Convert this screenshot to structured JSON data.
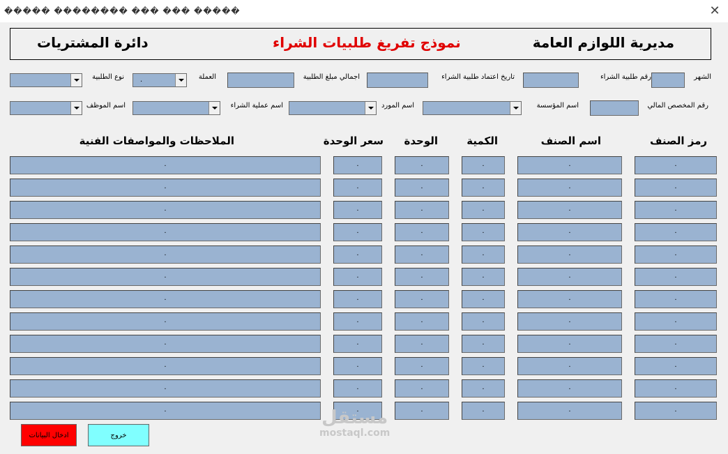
{
  "window": {
    "title": "����� �������� ��� ��� �����"
  },
  "header": {
    "org": "مديرية اللوازم العامة",
    "form_title": "نموذج تفريغ طلبيات الشراء",
    "dept": "دائرة المشتريات"
  },
  "colors": {
    "field": "#9ab3d1",
    "title_red": "#e00000",
    "btn_enter": "#ff0000",
    "btn_exit": "#80ffff"
  },
  "row1": {
    "month": "الشهر",
    "po_number": "رقم طلبية الشراء",
    "po_approval_date": "تاريخ اعتماد طلبية الشراء",
    "po_total": "اجمالي مبلغ الطلبية",
    "currency": "العملة",
    "currency_value": ".",
    "order_type": "نوع الطلبية"
  },
  "row2": {
    "allocation_no": "رقم المخصص المالي",
    "institution": "اسم المؤسسة",
    "supplier": "اسم المورد",
    "purchase_process": "اسم عملية الشراء",
    "employee": "اسم الموظف"
  },
  "columns": {
    "item_code": "رمز الصنف",
    "item_name": "اسم الصنف",
    "quantity": "الكمية",
    "unit": "الوحدة",
    "unit_price": "سعر الوحدة",
    "notes": "الملاحظات والمواصفات الفنية"
  },
  "cell_value": ".",
  "buttons": {
    "enter": "ادخال البيانات",
    "exit": "خروج"
  },
  "watermark": {
    "ar": "مستقل",
    "en": "mostaql.com"
  }
}
